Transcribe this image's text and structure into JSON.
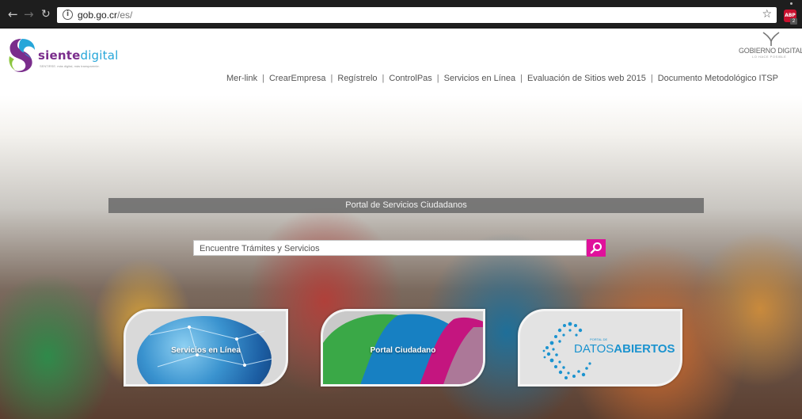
{
  "browser": {
    "url_host": "gob.go.cr",
    "url_path": "/es/",
    "ext_badge": "2",
    "ext_label": "ABP"
  },
  "logo": {
    "part1": "siente",
    "part2": "digital",
    "tagline": "SENTIRSE. más digital, más transparente."
  },
  "gobierno": {
    "title": "GOBIERNO DIGITAL",
    "tagline": "LO HACE POSIBLE"
  },
  "nav": {
    "items": [
      "Mer-link",
      "CrearEmpresa",
      "Regístrelo",
      "ControlPas",
      "Servicios en Línea",
      "Evaluación de Sitios web 2015",
      "Documento Metodológico ITSP"
    ],
    "separator": "|"
  },
  "hero": {
    "banner_title": "Portal de Servicios Ciudadanos",
    "search_placeholder": "Encuentre Trámites y Servicios"
  },
  "tiles": {
    "servicios": "Servicios en Línea",
    "portal": "Portal Ciudadano",
    "datos_small": "PORTAL DE",
    "datos_part1": "DATOS",
    "datos_part2": "ABIERTOS"
  },
  "colors": {
    "accent_magenta": "#e0119b",
    "logo_purple": "#7a2d8c",
    "logo_blue": "#26a6d9",
    "datos_blue": "#1b93cf"
  },
  "icons": {
    "back": "arrow-left-icon",
    "forward": "arrow-right-icon",
    "reload": "reload-icon",
    "info": "info-icon",
    "bookmark": "star-icon",
    "search": "magnifier-icon"
  }
}
